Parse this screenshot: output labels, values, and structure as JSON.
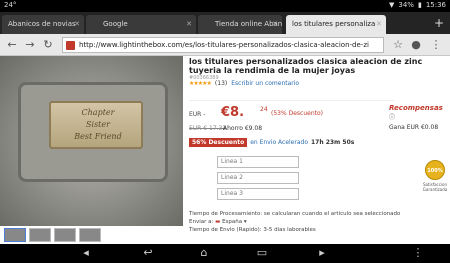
{
  "status": {
    "time_left": "24°",
    "battery": "34%",
    "clock": "15:36"
  },
  "tabs": [
    {
      "label": "Abanicos de novias"
    },
    {
      "label": "Google"
    },
    {
      "label": "Tienda online Abanicos"
    },
    {
      "label": "los titulares personaliza"
    }
  ],
  "address": {
    "url": "http://www.lightinthebox.com/es/los-titulares-personalizados-clasica-aleacion-de-zi"
  },
  "product": {
    "title": "los titulares personalizados clasica aleacion de zinc tuyeria la rendimia de la mujer joyas",
    "product_id": "#00366389",
    "stars": "★★★★★",
    "rating_count": "(13)",
    "review_link": "Escribir un comentario",
    "engraving_line1": "Sister",
    "engraving_line2": "Best Friend",
    "engraving_line0": "Chapter"
  },
  "price": {
    "currency": "EUR -",
    "main": "€8.",
    "cents": "24",
    "discount": "(53% Descuento)",
    "old": "EUR € 17.33",
    "save": "Ahorro €9.08"
  },
  "rewards": {
    "title": "Recompensas",
    "info": "ⓘ",
    "value": "Gana EUR €0.08"
  },
  "promo": {
    "badge": "56% Descuento",
    "link": "en Envio Acelerado",
    "timer": "17h 23m 50s"
  },
  "inputs": [
    {
      "placeholder": "Linea 1"
    },
    {
      "placeholder": "Linea 2"
    },
    {
      "placeholder": "Linea 3"
    }
  ],
  "satisfaction": {
    "badge": "100%",
    "label": "Satisfaccion Garantizada"
  },
  "meta": {
    "processing": "Tiempo de Procesamiento: se calcularan cuando el articulo sea seleccionado",
    "ship_to_label": "Enviar a:",
    "ship_to_value": "España",
    "ship_time": "Tiempo de Envio (Rapido): 3-5 dias laborables"
  }
}
